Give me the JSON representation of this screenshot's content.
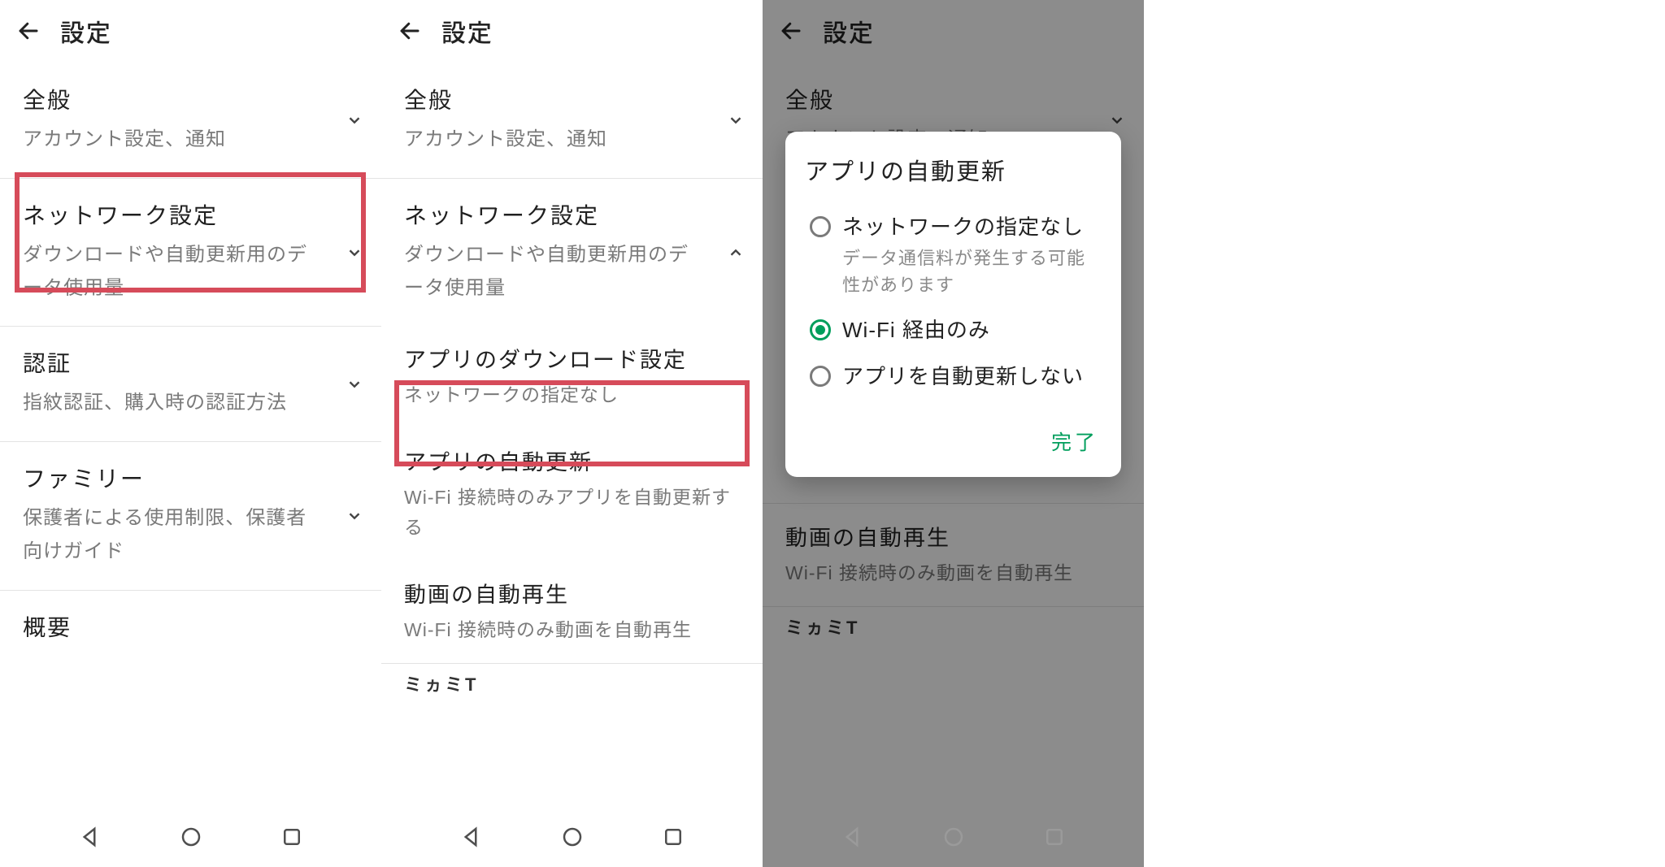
{
  "header": {
    "title": "設定"
  },
  "panel1": {
    "sections": [
      {
        "title": "全般",
        "subtitle": "アカウント設定、通知",
        "expand": "down"
      },
      {
        "title": "ネットワーク設定",
        "subtitle": "ダウンロードや自動更新用のデータ使用量",
        "expand": "down",
        "highlighted": true
      },
      {
        "title": "認証",
        "subtitle": "指紋認証、購入時の認証方法",
        "expand": "down"
      },
      {
        "title": "ファミリー",
        "subtitle": "保護者による使用制限、保護者向けガイド",
        "expand": "down"
      },
      {
        "title": "概要",
        "subtitle": ""
      }
    ]
  },
  "panel2": {
    "sections": [
      {
        "title": "全般",
        "subtitle": "アカウント設定、通知",
        "expand": "down"
      },
      {
        "title": "ネットワーク設定",
        "subtitle": "ダウンロードや自動更新用のデータ使用量",
        "expand": "up"
      }
    ],
    "subitems": [
      {
        "title": "アプリのダウンロード設定",
        "subtitle": "ネットワークの指定なし"
      },
      {
        "title": "アプリの自動更新",
        "subtitle": "Wi-Fi 接続時のみアプリを自動更新する",
        "highlighted": true
      },
      {
        "title": "動画の自動再生",
        "subtitle": "Wi-Fi 接続時のみ動画を自動再生"
      }
    ],
    "bottom_cut": "ミヵミT"
  },
  "panel3": {
    "sections": [
      {
        "title": "全般",
        "subtitle": "アカウント設定、通知",
        "expand": "down"
      }
    ],
    "subitems_after": [
      {
        "title": "動画の自動再生",
        "subtitle": "Wi-Fi 接続時のみ動画を自動再生"
      }
    ],
    "bottom_cut": "ミヵミT",
    "dialog": {
      "title": "アプリの自動更新",
      "options": [
        {
          "label": "ネットワークの指定なし",
          "note": "データ通信料が発生する可能性があります",
          "selected": false
        },
        {
          "label": "Wi-Fi 経由のみ",
          "note": "",
          "selected": true
        },
        {
          "label": "アプリを自動更新しない",
          "note": "",
          "selected": false
        }
      ],
      "done": "完了"
    }
  },
  "icons": {
    "back": "back-arrow-icon",
    "chevron_down": "chevron-down-icon",
    "chevron_up": "chevron-up-icon",
    "nav_back": "nav-back-triangle-icon",
    "nav_home": "nav-home-circle-icon",
    "nav_recent": "nav-recent-square-icon",
    "radio": "radio-icon"
  }
}
